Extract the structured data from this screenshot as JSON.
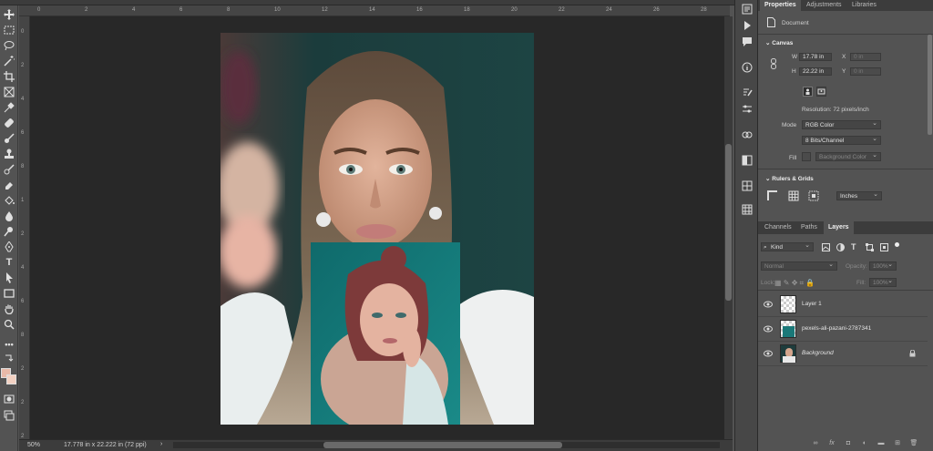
{
  "rulers": {
    "top": [
      "0",
      "2",
      "4",
      "6",
      "8",
      "10",
      "12",
      "14",
      "16",
      "18",
      "20",
      "22",
      "24",
      "26",
      "28"
    ],
    "left": [
      "0",
      "2",
      "4",
      "6",
      "8",
      "1",
      "2",
      "4",
      "6",
      "8",
      "2",
      "2",
      "2"
    ]
  },
  "status": {
    "zoom": "50%",
    "doc_info": "17.778 in x 22.222 in (72 ppi)",
    "arrow": "›"
  },
  "properties_panel": {
    "tabs": [
      "Properties",
      "Adjustments",
      "Libraries"
    ],
    "active_tab": "Properties",
    "document_label": "Document",
    "canvas": {
      "section_title": "Canvas",
      "w_label": "W",
      "w_value": "17.78 in",
      "x_label": "X",
      "x_value": "0 in",
      "h_label": "H",
      "h_value": "22.22 in",
      "y_label": "Y",
      "y_value": "0 in",
      "resolution": "Resolution: 72 pixels/inch",
      "mode_label": "Mode",
      "mode_value": "RGB Color",
      "bits_value": "8 Bits/Channel",
      "fill_label": "Fill",
      "fill_value": "Background Color"
    },
    "rulers_grids": {
      "section_title": "Rulers & Grids",
      "units_value": "Inches"
    }
  },
  "layers_panel": {
    "tabs": [
      "Channels",
      "Paths",
      "Layers"
    ],
    "active_tab": "Layers",
    "filter_value": "Kind",
    "blend_mode": "Normal",
    "opacity_label": "Opacity:",
    "opacity_value": "100%",
    "lock_label": "Lock:",
    "fill_label": "Fill:",
    "fill_value": "100%",
    "layers": [
      {
        "name": "Layer 1"
      },
      {
        "name": "pexels-ali-pazani-2787341"
      },
      {
        "name": "Background"
      }
    ]
  },
  "colors": {
    "foreground": "#e8b9a8",
    "background": "#f2d1c2",
    "panel_bg": "#535353",
    "workspace_bg": "#282828"
  }
}
